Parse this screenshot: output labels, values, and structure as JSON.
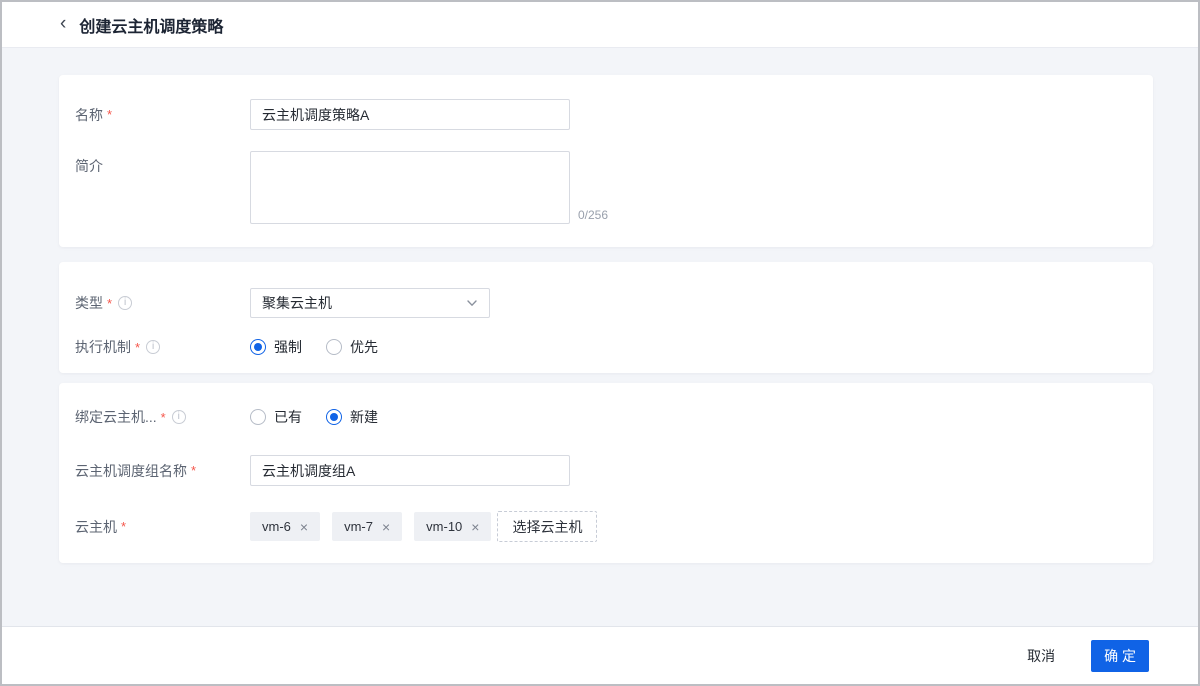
{
  "header": {
    "title": "创建云主机调度策略"
  },
  "icons": {
    "back": "‹",
    "close": "×",
    "info": "i",
    "required": "*"
  },
  "form": {
    "name": {
      "label": "名称",
      "value": "云主机调度策略A"
    },
    "description": {
      "label": "简介",
      "value": "",
      "counter": "0/256"
    },
    "type": {
      "label": "类型",
      "value": "聚集云主机"
    },
    "mechanism": {
      "label": "执行机制",
      "options": [
        {
          "label": "强制",
          "checked": true
        },
        {
          "label": "优先",
          "checked": false
        }
      ]
    },
    "bind_group": {
      "label": "绑定云主机...",
      "options": [
        {
          "label": "已有",
          "checked": false
        },
        {
          "label": "新建",
          "checked": true
        }
      ]
    },
    "group_name": {
      "label": "云主机调度组名称",
      "value": "云主机调度组A"
    },
    "vms": {
      "label": "云主机",
      "tags": [
        "vm-6",
        "vm-7",
        "vm-10"
      ],
      "select_button": "选择云主机"
    }
  },
  "footer": {
    "cancel": "取消",
    "confirm": "确 定"
  },
  "colors": {
    "accent": "#1063e6"
  }
}
